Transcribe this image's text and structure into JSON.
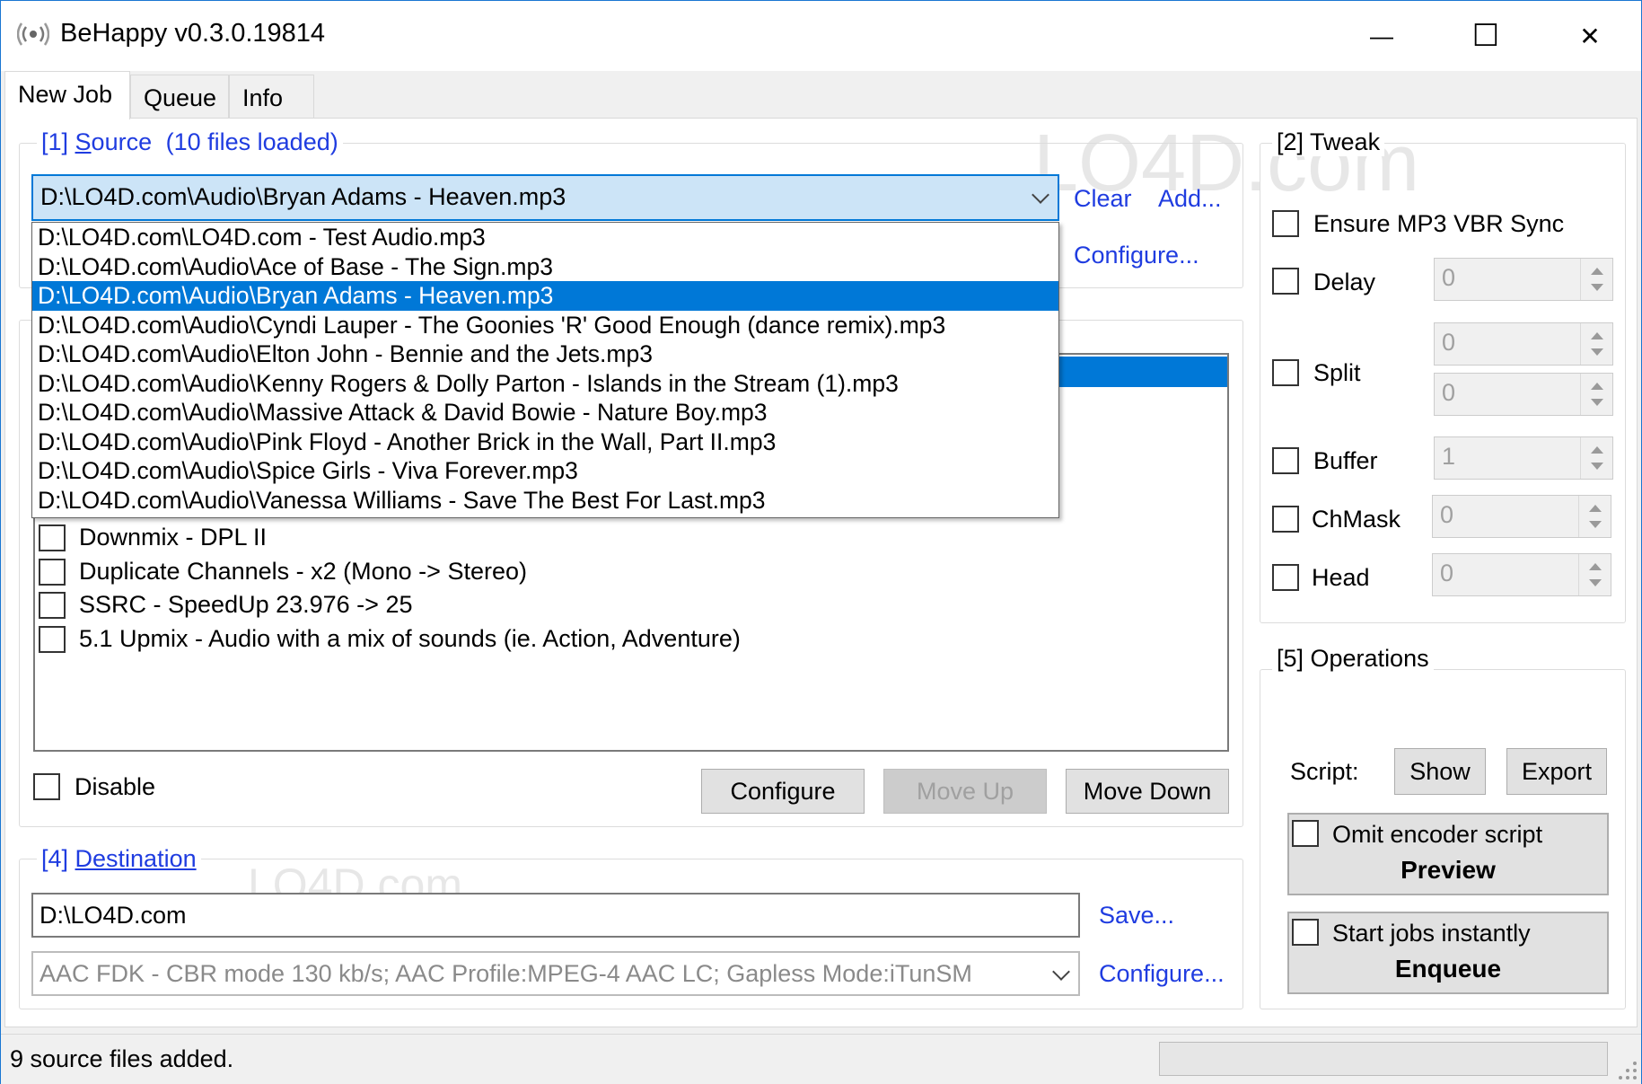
{
  "window": {
    "title": "BeHappy v0.3.0.19814",
    "minimize": "—",
    "maximize": "☐",
    "close": "✕"
  },
  "tabs": [
    "New Job",
    "Queue",
    "Info"
  ],
  "source": {
    "legend_prefix": "[1] ",
    "legend_link": "S",
    "legend_rest": "ource",
    "files_loaded": "(10 files loaded)",
    "selected_file": "D:\\LO4D.com\\Audio\\Bryan Adams - Heaven.mp3",
    "clear": "Clear",
    "add": "Add...",
    "configure": "Configure...",
    "files": [
      "D:\\LO4D.com\\LO4D.com - Test Audio.mp3",
      "D:\\LO4D.com\\Audio\\Ace of Base - The Sign.mp3",
      "D:\\LO4D.com\\Audio\\Bryan Adams - Heaven.mp3",
      "D:\\LO4D.com\\Audio\\Cyndi Lauper - The Goonies 'R' Good Enough (dance remix).mp3",
      "D:\\LO4D.com\\Audio\\Elton John - Bennie and the Jets.mp3",
      "D:\\LO4D.com\\Audio\\Kenny Rogers & Dolly Parton - Islands in the Stream (1).mp3",
      "D:\\LO4D.com\\Audio\\Massive Attack & David Bowie - Nature Boy.mp3",
      "D:\\LO4D.com\\Audio\\Pink Floyd - Another Brick in the Wall, Part II.mp3",
      "D:\\LO4D.com\\Audio\\Spice Girls - Viva Forever.mp3",
      "D:\\LO4D.com\\Audio\\Vanessa Williams - Save The Best For Last.mp3"
    ]
  },
  "dsp": {
    "items": [
      "Downmix - DPL II",
      "Duplicate Channels - x2 (Mono -> Stereo)",
      "SSRC - SpeedUp 23.976 -> 25",
      "5.1 Upmix - Audio with a mix of sounds (ie. Action, Adventure)"
    ],
    "disable": "Disable",
    "configure": "Configure",
    "move_up": "Move Up",
    "move_down": "Move Down"
  },
  "tweak": {
    "legend": "[2] Tweak",
    "ensure_mp3": "Ensure MP3 VBR Sync",
    "delay": "Delay",
    "split": "Split",
    "buffer": "Buffer",
    "chmask": "ChMask",
    "head": "Head",
    "delay_val": "0",
    "split_val1": "0",
    "split_val2": "0",
    "buffer_val": "1",
    "chmask_val": "0",
    "head_val": "0"
  },
  "operations": {
    "legend": "[5] Operations",
    "script_label": "Script:",
    "show": "Show",
    "export": "Export",
    "omit_encoder": "Omit encoder script",
    "preview": "Preview",
    "start_instantly": "Start jobs instantly",
    "enqueue": "Enqueue"
  },
  "destination": {
    "legend_prefix": "[4] ",
    "legend_link": "Destination",
    "path": "D:\\LO4D.com",
    "save": "Save...",
    "encoder": "AAC FDK - CBR mode 130 kb/s; AAC Profile:MPEG-4 AAC LC; Gapless Mode:iTunSM",
    "configure": "Configure..."
  },
  "status": {
    "text": "9 source files added.",
    "progress": 0
  },
  "watermark": {
    "text1": "LO4D.com",
    "text2": "LO4D.com"
  }
}
